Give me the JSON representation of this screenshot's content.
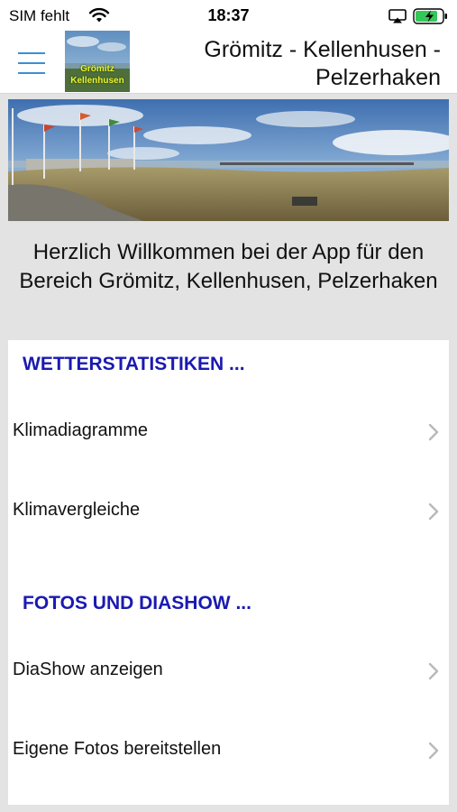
{
  "status_bar": {
    "carrier": "SIM fehlt",
    "time": "18:37",
    "battery_color": "#34c759"
  },
  "nav": {
    "title": "Grömitz - Kellenhusen - Pelzerhaken",
    "logo_lines": [
      "Grömitz",
      "Kellenhusen"
    ],
    "accent_color": "#3a8fd9"
  },
  "welcome": {
    "text": "Herzlich Willkommen bei der App für den Bereich Grömitz, Kellenhusen, Pelzerhaken"
  },
  "sections": [
    {
      "title": "WETTERSTATISTIKEN ...",
      "items": [
        {
          "label": "Klimadiagramme",
          "icon": "chevron-right-icon"
        },
        {
          "label": "Klimavergleiche",
          "icon": "chevron-right-icon"
        }
      ]
    },
    {
      "title": "FOTOS UND DIASHOW ...",
      "items": [
        {
          "label": "DiaShow anzeigen",
          "icon": "chevron-right-icon"
        },
        {
          "label": "Eigene Fotos bereitstellen",
          "icon": "chevron-right-icon"
        }
      ]
    }
  ],
  "colors": {
    "section_header": "#1a1ab0",
    "page_background": "#e3e3e3"
  }
}
